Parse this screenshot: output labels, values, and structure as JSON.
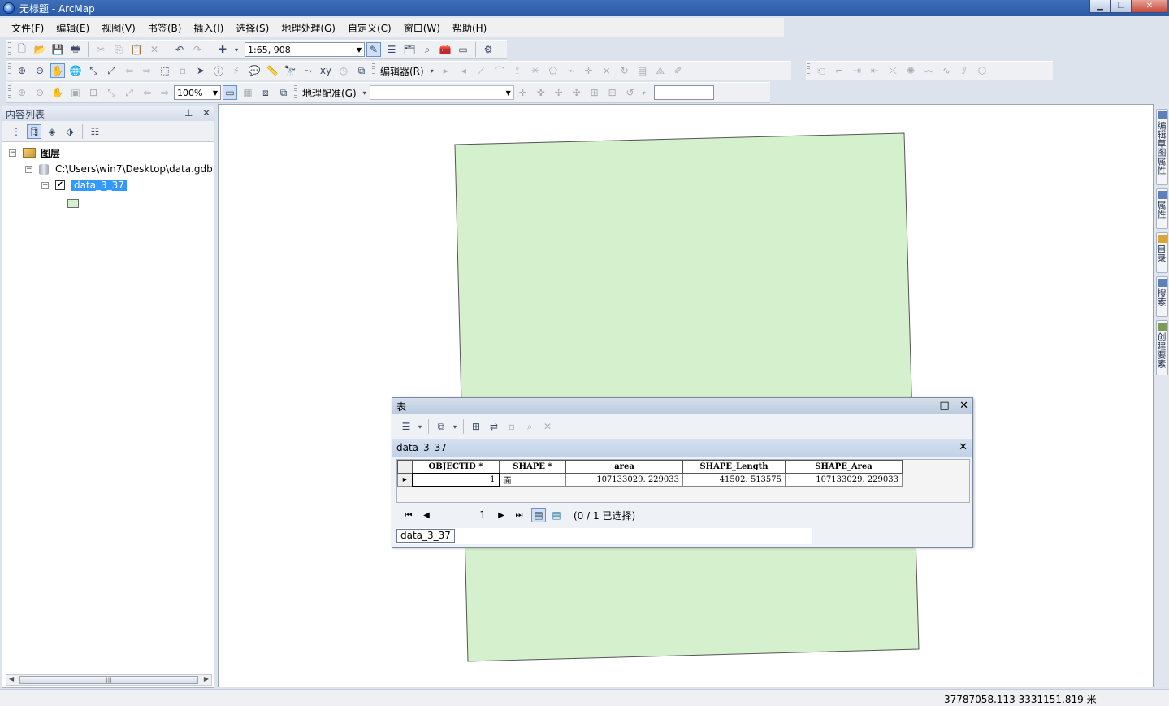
{
  "window": {
    "title": "无标题 - ArcMap"
  },
  "menu": [
    "文件(F)",
    "编辑(E)",
    "视图(V)",
    "书签(B)",
    "插入(I)",
    "选择(S)",
    "地理处理(G)",
    "自定义(C)",
    "窗口(W)",
    "帮助(H)"
  ],
  "toolbar": {
    "scale": "1:65, 908",
    "editor_label": "编辑器(R)",
    "zoom_percent": "100%",
    "georef_label": "地理配准(G)"
  },
  "toc": {
    "title": "内容列表",
    "layers_root": "图层",
    "database": "C:\\Users\\win7\\Desktop\\data.gdb",
    "layer": "data_3_37"
  },
  "right_dock": {
    "tabs": [
      "编辑草图属性",
      "属性",
      "目录",
      "搜索",
      "创建要素"
    ]
  },
  "table_window": {
    "title": "表",
    "table_name": "data_3_37",
    "columns": [
      "OBJECTID *",
      "SHAPE *",
      "area",
      "SHAPE_Length",
      "SHAPE_Area"
    ],
    "rows": [
      {
        "objectid": "1",
        "shape": "面",
        "area": "107133029. 229033",
        "shape_length": "41502. 513575",
        "shape_area": "107133029. 229033"
      }
    ],
    "current_record": "1",
    "selection_status": "(0 / 1 已选择)",
    "bottom_tab": "data_3_37"
  },
  "status": {
    "coordinates": "37787058.113  3331151.819 米"
  },
  "colors": {
    "polygon_fill": "#d4f0cc",
    "polygon_stroke": "#555555",
    "selection": "#3399ff",
    "title_bar": "#2a5aa6"
  }
}
